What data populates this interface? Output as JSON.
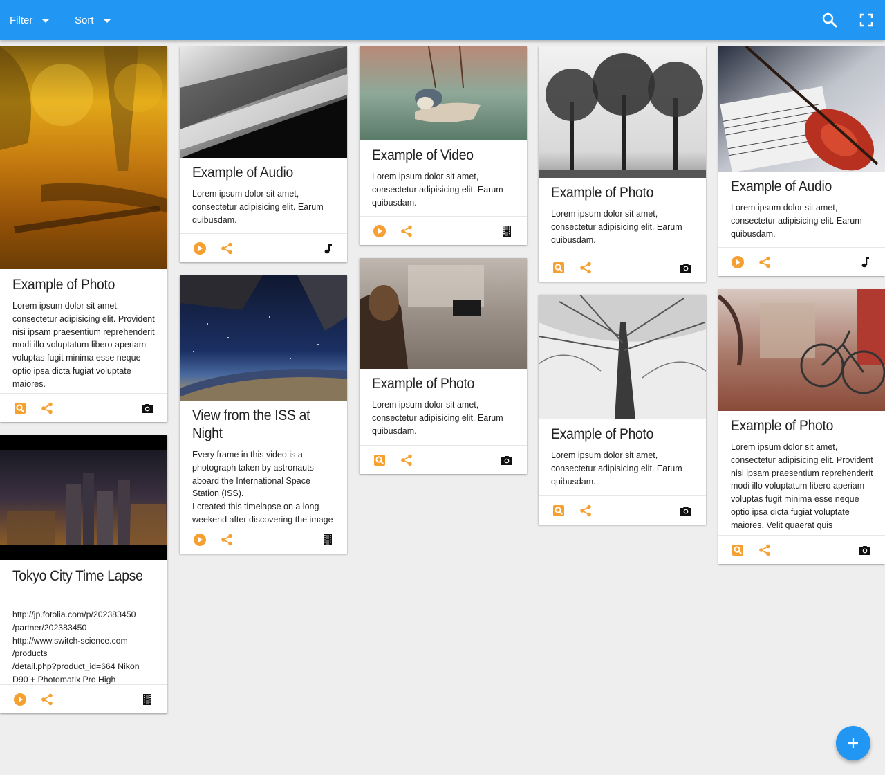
{
  "toolbar": {
    "filter_label": "Filter",
    "sort_label": "Sort",
    "search_icon": "search-icon",
    "fullscreen_icon": "fullscreen-icon"
  },
  "colors": {
    "appbar": "#2196f3",
    "accent": "#f5a030",
    "background": "#eeeeee"
  },
  "cards": [
    {
      "title": "Example of Photo",
      "type": "photo",
      "image": "autumn forest with reflecting stream",
      "description": "Lorem ipsum dolor sit amet, consectetur adipisicing elit. Provident nisi ipsam praesentium reprehenderit modi illo voluptatum libero aperiam voluptas fugit minima esse neque optio ipsa dicta fugiat voluptate maiores."
    },
    {
      "title": "Tokyo City Time Lapse",
      "type": "video",
      "image": "Tokyo skyline at night",
      "description": "http://jp.fotolia.com/p/202383450\n/partner/202383450\nhttp://www.switch-science.com\n/products\n/detail.php?product_id=664 Nikon D90 + Photomatix Pro High"
    },
    {
      "title": "Example of Audio",
      "type": "audio",
      "image": "piano keys close-up",
      "description": "Lorem ipsum dolor sit amet, consectetur adipisicing elit. Earum quibusdam."
    },
    {
      "title": "View from the ISS at Night",
      "type": "video",
      "image": "earth at night seen from space station",
      "description": "Every frame in this video is a photograph taken by astronauts aboard the International Space Station (ISS).\nI created this timelapse on a long weekend after discovering the image"
    },
    {
      "title": "Example of Video",
      "type": "video",
      "image": "bird perched on hanging feeder",
      "description": "Lorem ipsum dolor sit amet, consectetur adipisicing elit. Earum quibusdam."
    },
    {
      "title": "Example of Photo",
      "type": "photo",
      "image": "photographer shooting a piano in a plaza",
      "description": "Lorem ipsum dolor sit amet, consectetur adipisicing elit. Earum quibusdam."
    },
    {
      "title": "Example of Photo",
      "type": "photo",
      "image": "black and white silhouette trees",
      "description": "Lorem ipsum dolor sit amet, consectetur adipisicing elit. Earum quibusdam."
    },
    {
      "title": "Example of Photo",
      "type": "photo",
      "image": "looking up a tall tree trunk",
      "description": "Lorem ipsum dolor sit amet, consectetur adipisicing elit. Earum quibusdam."
    },
    {
      "title": "Example of Audio",
      "type": "audio",
      "image": "violin on sheet music",
      "description": "Lorem ipsum dolor sit amet, consectetur adipisicing elit. Earum quibusdam."
    },
    {
      "title": "Example of Photo",
      "type": "photo",
      "image": "bicycle on autumn leaves",
      "description": "Lorem ipsum dolor sit amet, consectetur adipisicing elit. Provident nisi ipsam praesentium reprehenderit modi illo voluptatum libero aperiam voluptas fugit minima esse neque optio ipsa dicta fugiat voluptate maiores. Velit quaerat quis"
    }
  ],
  "fab": {
    "icon": "add-icon"
  }
}
